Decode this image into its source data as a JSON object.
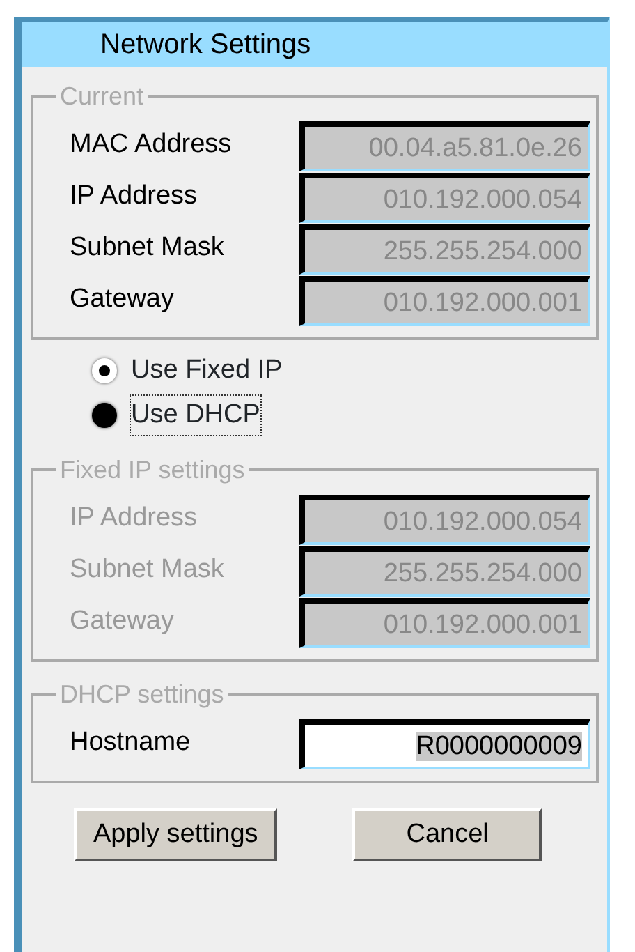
{
  "window": {
    "title": "Network Settings"
  },
  "groups": [
    {
      "kind": "fields",
      "title": "Current",
      "disabled": false,
      "rows": [
        {
          "label": "MAC Address",
          "value": "00.04.a5.81.0e.26",
          "disabled": true
        },
        {
          "label": "IP Address",
          "value": "010.192.000.054",
          "disabled": true
        },
        {
          "label": "Subnet Mask",
          "value": "255.255.254.000",
          "disabled": true
        },
        {
          "label": "Gateway",
          "value": "010.192.000.001",
          "disabled": true
        }
      ]
    },
    {
      "kind": "radios",
      "options": [
        {
          "label": "Use Fixed IP",
          "selected": true,
          "focused": false
        },
        {
          "label": "Use DHCP",
          "selected": false,
          "focused": true
        }
      ]
    },
    {
      "kind": "fields",
      "title": "Fixed IP settings",
      "disabled": true,
      "rows": [
        {
          "label": "IP Address",
          "value": "010.192.000.054",
          "disabled": true
        },
        {
          "label": "Subnet Mask",
          "value": "255.255.254.000",
          "disabled": true
        },
        {
          "label": "Gateway",
          "value": "010.192.000.001",
          "disabled": true
        }
      ]
    },
    {
      "kind": "fields",
      "title": "DHCP settings",
      "disabled": false,
      "rows": [
        {
          "label": "Hostname",
          "value": "R0000000009",
          "disabled": false,
          "highlighted": true
        }
      ]
    }
  ],
  "buttons": [
    "Apply settings",
    "Cancel"
  ]
}
